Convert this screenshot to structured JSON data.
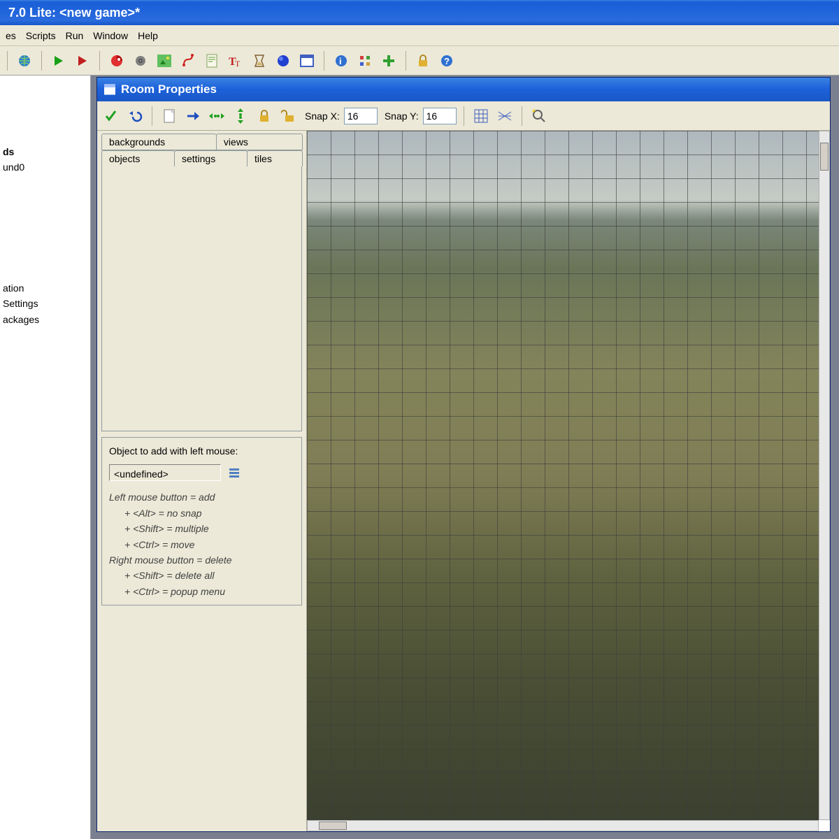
{
  "window_title": "7.0 Lite:  <new game>*",
  "menu": {
    "resources": "es",
    "scripts": "Scripts",
    "run": "Run",
    "window": "Window",
    "help": "Help"
  },
  "sidebar": {
    "backgrounds_header": "ds",
    "background_item": "und0",
    "info_line": "ation",
    "settings_line": "Settings",
    "packages_line": "ackages"
  },
  "room": {
    "title": "Room Properties",
    "snapx_label": "Snap X:",
    "snapy_label": "Snap Y:",
    "snapx": "16",
    "snapy": "16",
    "tabs": {
      "backgrounds": "backgrounds",
      "views": "views",
      "objects": "objects",
      "settings": "settings",
      "tiles": "tiles"
    },
    "obj_label": "Object to add with left mouse:",
    "obj_value": "<undefined>",
    "help": {
      "l1": "Left mouse button = add",
      "l2": "+ <Alt> = no snap",
      "l3": "+ <Shift> = multiple",
      "l4": "+ <Ctrl> = move",
      "l5": "Right mouse button = delete",
      "l6": "+ <Shift> = delete all",
      "l7": "+ <Ctrl> = popup menu"
    }
  }
}
